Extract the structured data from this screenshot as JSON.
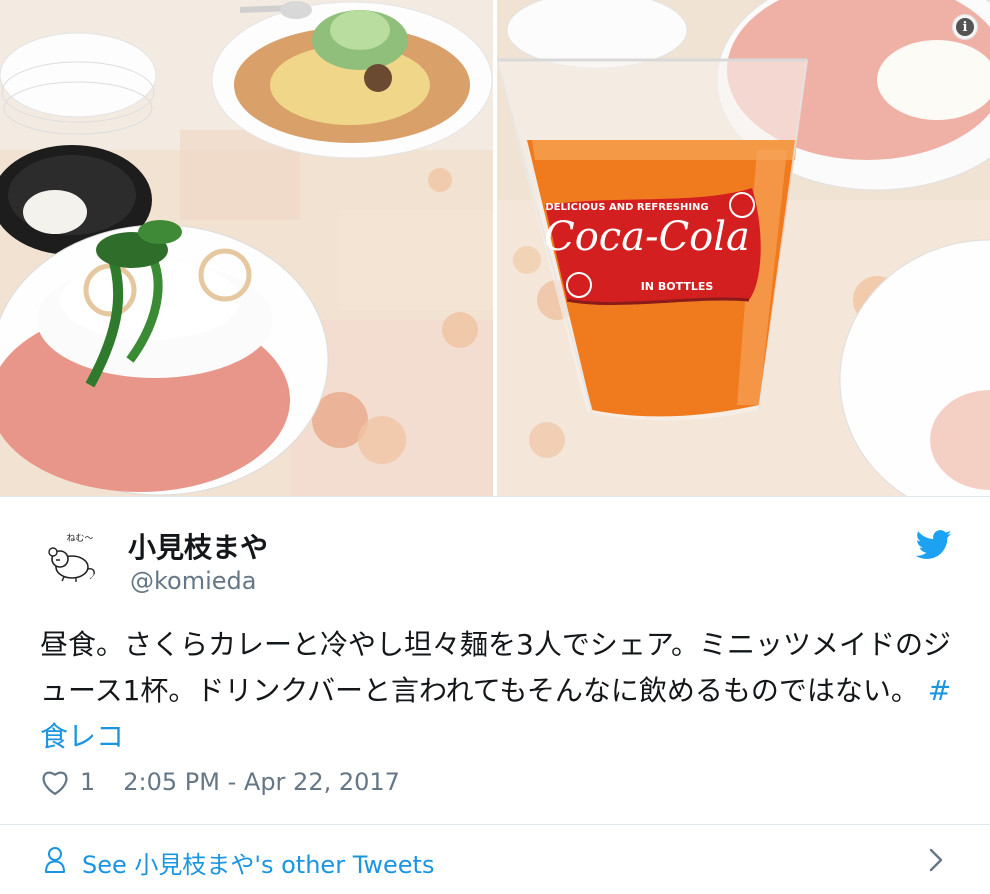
{
  "tweet": {
    "author_name": "小見枝まや",
    "author_handle": "@komieda",
    "text_body": "昼食。さくらカレーと冷やし坦々麺を3人でシェア。ミニッツメイドのジュース1杯。ドリンクバーと言われてもそんなに飲めるものではない。",
    "hashtag": "#食レコ",
    "like_count": "1",
    "timestamp": "2:05 PM - Apr 22, 2017",
    "avatar_text": "ねむ〜"
  },
  "footer": {
    "label": "See 小見枝まや's other Tweets"
  },
  "photos": {
    "glass_brand": "Coca-Cola",
    "glass_slogan": "DELICIOUS AND REFRESHING",
    "glass_bottom": "IN BOTTLES"
  },
  "icons": {
    "info": "info-icon",
    "twitter": "twitter-bird-icon",
    "heart": "heart-icon",
    "person": "person-icon",
    "chevron": "chevron-right-icon"
  },
  "colors": {
    "link": "#1b95e0",
    "text": "#14171a",
    "secondary": "#657786",
    "divider": "#e1e8ed"
  }
}
